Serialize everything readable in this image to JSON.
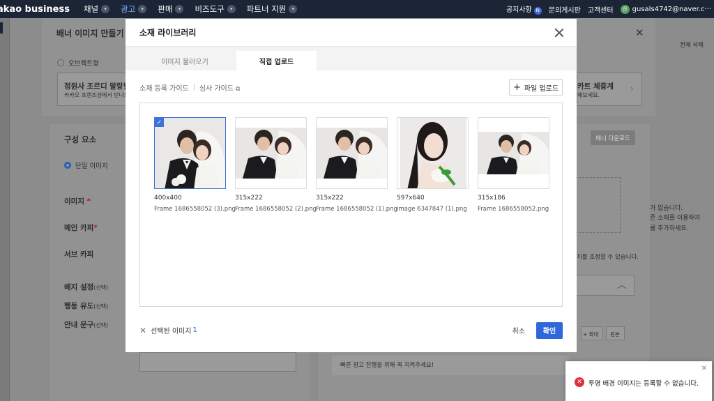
{
  "nav": {
    "brand": "akao business",
    "items": [
      {
        "label": "채널"
      },
      {
        "label": "광고"
      },
      {
        "label": "판매"
      },
      {
        "label": "비즈도구"
      },
      {
        "label": "파트너 지원"
      }
    ],
    "notice": "공지사항",
    "notice_badge": "N",
    "board": "문의게시판",
    "support": "고객센터",
    "avatar_initial": "신",
    "account": "gusals4742@naver.c···"
  },
  "background": {
    "title": "배너 이미지 만들기",
    "delete_all": "전체 삭제",
    "object_type": "오브젝트형",
    "promo_title": "정원사 조르디 말랑필요",
    "promo_desc": "카카오 프렌즈샵에서 만나보",
    "promo_right_title": "카트 체중계",
    "promo_right_desc": "해보세요.",
    "section_title": "구성 요소",
    "single_image": "단일 이미지",
    "banner_download": "배너 다운로드",
    "field_image": "이미지",
    "field_main_copy": "메인 카피",
    "field_sub_copy": "서브 카피",
    "field_badge": "배지 설정",
    "field_cta": "행동 유도",
    "field_notice": "안내 문구",
    "optional": "(선택)",
    "required_mark": "*",
    "empty_text_1": "가 없습니다.",
    "empty_text_2": "존 소재를 이용하여",
    "empty_text_3": "를 추가하세요.",
    "adjust_text": "치를 조정할 수 있습니다.",
    "zoom_in": "+ 확대",
    "original": "원본",
    "guide_notice": "빠른 광고 진행을 위해 꼭 지켜주세요!"
  },
  "modal": {
    "title": "소재 라이브러리",
    "tabs": [
      "이미지 불러오기",
      "직접 업로드"
    ],
    "active_tab": 1,
    "guide_register": "소재 등록 가이드",
    "guide_review": "심사 가이드",
    "upload_button": "파일 업로드",
    "images": [
      {
        "size": "400x400",
        "name": "Frame 1686558052 (3).png",
        "selected": true
      },
      {
        "size": "315x222",
        "name": "Frame 1686558052 (2).png",
        "selected": false
      },
      {
        "size": "315x222",
        "name": "Frame 1686558052 (1).png",
        "selected": false
      },
      {
        "size": "597x640",
        "name": "image 6347847 (1).png",
        "selected": false
      },
      {
        "size": "315x186",
        "name": "Frame 1686558052.png",
        "selected": false
      }
    ],
    "selected_label": "선택된 이미지",
    "selected_count": "1",
    "cancel": "취소",
    "confirm": "확인"
  },
  "toast": {
    "message": "투명 배경 이미지는 등록할 수 없습니다."
  },
  "colors": {
    "accent": "#2f69d9",
    "nav_bg": "#1c2536",
    "error": "#e0303a"
  }
}
